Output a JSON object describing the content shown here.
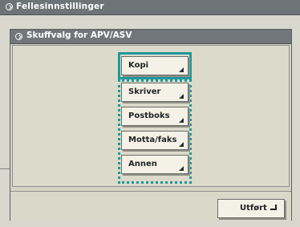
{
  "app": {
    "title": "Fellesinnstillinger"
  },
  "dialog": {
    "title": "Skuffvalg for APV/ASV",
    "options": [
      {
        "label": "Kopi"
      },
      {
        "label": "Skriver"
      },
      {
        "label": "Postboks"
      },
      {
        "label": "Motta/faks"
      },
      {
        "label": "Annen"
      }
    ],
    "done_label": "Utført"
  },
  "colors": {
    "accent": "#1f9999",
    "titlebar": "#6d7377",
    "panel": "#d9d8ce"
  }
}
